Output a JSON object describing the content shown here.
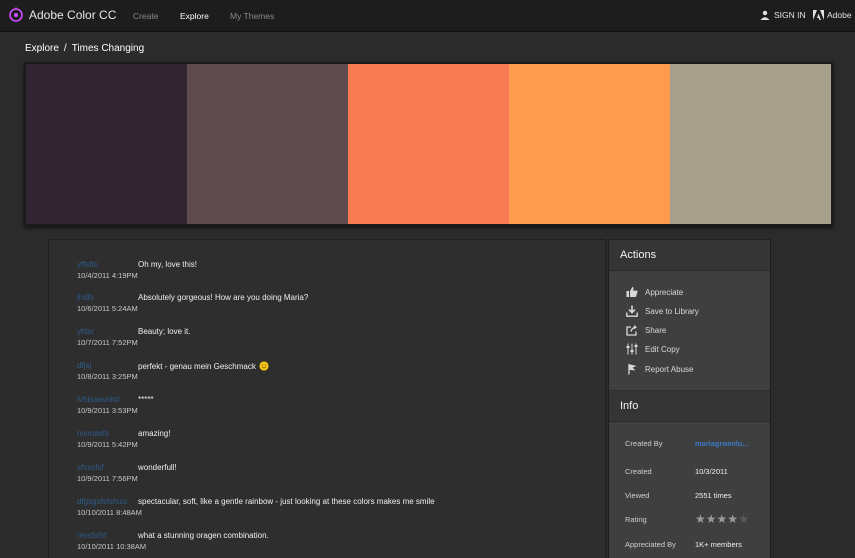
{
  "app": {
    "name": "Adobe Color CC"
  },
  "nav": {
    "create": "Create",
    "explore": "Explore",
    "my_themes": "My Themes"
  },
  "account": {
    "sign_in": "SIGN IN",
    "adobe": "Adobe"
  },
  "breadcrumb": {
    "root": "Explore",
    "separator": "/",
    "current": "Times Changing"
  },
  "palette": [
    "#31232f",
    "#5f4b4f",
    "#f77b53",
    "#fe9b4e",
    "#a59f8b"
  ],
  "comments": [
    {
      "user": "yffsfts",
      "text": "Oh my, love this!",
      "date": "10/4/2011 4:19PM"
    },
    {
      "user": "jhdfs",
      "text": "Absolutely gorgeous! How are you doing Maria?",
      "date": "10/6/2011 5:24AM"
    },
    {
      "user": "yfdsr",
      "text": "Beauty; love it.",
      "date": "10/7/2011 7:52PM"
    },
    {
      "user": "dfjsj",
      "text": "perfekt - genau mein Geschmack",
      "date": "10/8/2011 3:25PM",
      "emoji": "smiley-icon"
    },
    {
      "user": "lvfdsaavshd",
      "text": "*****",
      "date": "10/9/2011 3:53PM"
    },
    {
      "user": "mvmasfs",
      "text": "amazing!",
      "date": "10/9/2011 5:42PM"
    },
    {
      "user": "sfsssfsf",
      "text": "wonderfull!",
      "date": "10/9/2011 7:56PM"
    },
    {
      "user": "dfgsgsfsfsfsss",
      "text": "spectacular, soft, like a gentle rainbow - just looking at these colors makes me smile",
      "date": "10/10/2011 8:48AM"
    },
    {
      "user": "mvsfsfsf",
      "text": "what a stunning oragen combination.",
      "date": "10/10/2011 10:38AM"
    }
  ],
  "actions": {
    "title": "Actions",
    "items": [
      {
        "label": "Appreciate",
        "icon": "thumbs-up-icon"
      },
      {
        "label": "Save to Library",
        "icon": "download-tray-icon"
      },
      {
        "label": "Share",
        "icon": "share-icon"
      },
      {
        "label": "Edit Copy",
        "icon": "sliders-icon"
      },
      {
        "label": "Report Abuse",
        "icon": "flag-icon"
      }
    ]
  },
  "info": {
    "title": "Info",
    "created_by_label": "Created By",
    "created_by_value": "mariagroenlu...",
    "created_label": "Created",
    "created_value": "10/3/2011",
    "viewed_label": "Viewed",
    "viewed_value": "2551 times",
    "rating_label": "Rating",
    "rating_value": 4,
    "rating_max": 5,
    "appreciated_label": "Appreciated By",
    "appreciated_value": "1K+ members"
  }
}
